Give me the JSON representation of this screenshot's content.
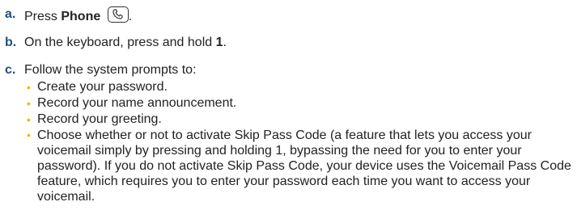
{
  "steps": [
    {
      "letter": "a.",
      "text_before": "Press ",
      "bold": "Phone",
      "text_after": " ",
      "icon": "phone-key-icon",
      "trail": "."
    },
    {
      "letter": "b.",
      "text_before": "On the keyboard, press and hold ",
      "bold": "1",
      "text_after": "."
    },
    {
      "letter": "c.",
      "text": "Follow the system prompts to:",
      "bullets": [
        "Create your password.",
        "Record your name announcement.",
        "Record your greeting.",
        "Choose whether or not to activate Skip Pass Code (a feature that lets you access your voicemail simply by pressing and holding 1, bypassing the need for you to enter your password). If you do not activate Skip Pass Code, your device uses the Voicemail Pass Code feature, which requires you to enter your password each time you want to access your voicemail."
      ]
    }
  ],
  "colors": {
    "step_letter": "#1f4f82",
    "bullet": "#f2b600",
    "text": "#222222"
  }
}
